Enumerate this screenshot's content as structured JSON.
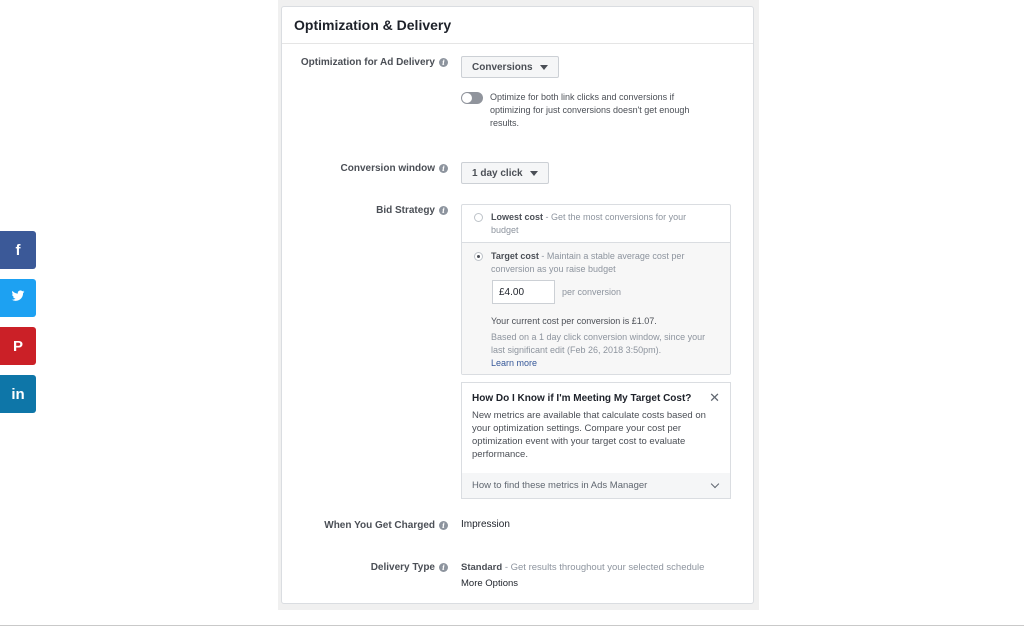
{
  "share": {
    "buttons": [
      {
        "label": "f",
        "color": "#3b5998",
        "icon": "facebook-icon"
      },
      {
        "label": "",
        "color": "#1da1f2",
        "icon": "twitter-icon"
      },
      {
        "label": "P",
        "color": "#cb2027",
        "icon": "pinterest-icon"
      },
      {
        "label": "in",
        "color": "#0e76a8",
        "icon": "linkedin-icon"
      }
    ]
  },
  "panel": {
    "title": "Optimization & Delivery"
  },
  "optimization": {
    "label": "Optimization for Ad Delivery",
    "value": "Conversions",
    "toggle_on": false,
    "toggle_text": "Optimize for both link clicks and conversions if optimizing for just conversions doesn't get enough results."
  },
  "conversion_window": {
    "label": "Conversion window",
    "value": "1 day click"
  },
  "bid_strategy": {
    "label": "Bid Strategy",
    "lowest_cost": {
      "title": "Lowest cost",
      "desc": "- Get the most conversions for your budget"
    },
    "target_cost": {
      "title": "Target cost",
      "desc": "- Maintain a stable average cost per conversion as you raise budget",
      "amount": "£4.00",
      "unit": "per conversion",
      "current": "Your current cost per conversion is £1.07.",
      "note": "Based on a 1 day click conversion window, since your last significant edit (Feb 26, 2018 3:50pm).",
      "learn_more": "Learn more"
    }
  },
  "tip": {
    "title": "How Do I Know if I'm Meeting My Target Cost?",
    "body": "New metrics are available that calculate costs based on your optimization settings. Compare your cost per optimization event with your target cost to evaluate performance.",
    "footer": "How to find these metrics in Ads Manager"
  },
  "charged": {
    "label": "When You Get Charged",
    "value": "Impression"
  },
  "delivery": {
    "label": "Delivery Type",
    "value_bold": "Standard",
    "value_desc": "- Get results throughout your selected schedule",
    "more": "More Options"
  }
}
